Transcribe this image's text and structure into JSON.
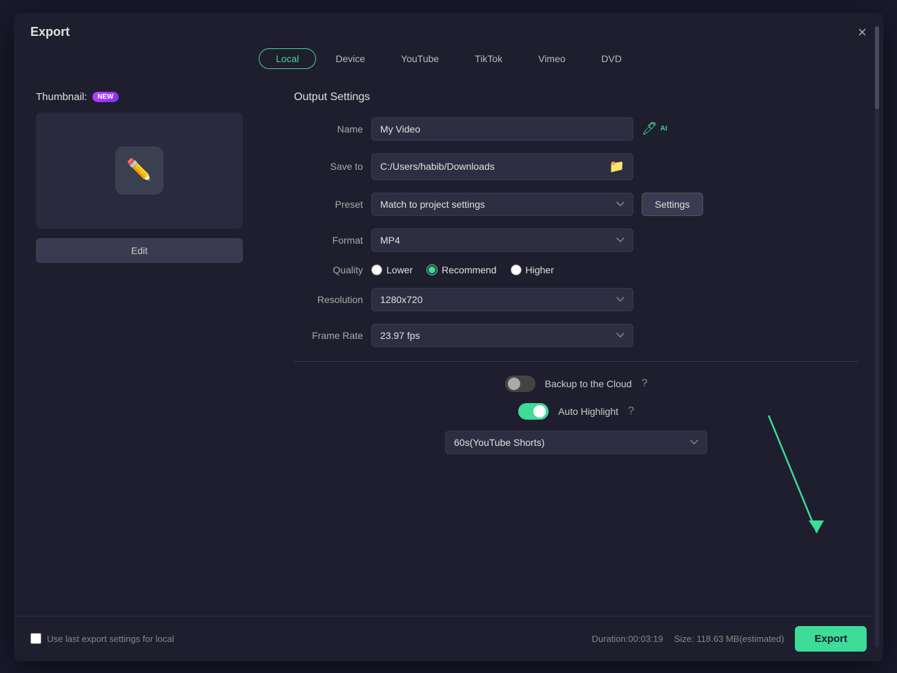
{
  "dialog": {
    "title": "Export",
    "close_label": "×"
  },
  "tabs": {
    "items": [
      {
        "id": "local",
        "label": "Local",
        "active": true
      },
      {
        "id": "device",
        "label": "Device",
        "active": false
      },
      {
        "id": "youtube",
        "label": "YouTube",
        "active": false
      },
      {
        "id": "tiktok",
        "label": "TikTok",
        "active": false
      },
      {
        "id": "vimeo",
        "label": "Vimeo",
        "active": false
      },
      {
        "id": "dvd",
        "label": "DVD",
        "active": false
      }
    ]
  },
  "left_panel": {
    "thumbnail_label": "Thumbnail:",
    "new_badge": "NEW",
    "edit_button": "Edit"
  },
  "output_settings": {
    "section_title": "Output Settings",
    "name_label": "Name",
    "name_value": "My Video",
    "save_to_label": "Save to",
    "save_to_value": "C:/Users/habib/Downloads",
    "preset_label": "Preset",
    "preset_value": "Match to project settings",
    "settings_button": "Settings",
    "format_label": "Format",
    "format_value": "MP4",
    "quality_label": "Quality",
    "quality_options": [
      {
        "id": "lower",
        "label": "Lower",
        "checked": false
      },
      {
        "id": "recommend",
        "label": "Recommend",
        "checked": true
      },
      {
        "id": "higher",
        "label": "Higher",
        "checked": false
      }
    ],
    "resolution_label": "Resolution",
    "resolution_value": "1280x720",
    "framerate_label": "Frame Rate",
    "framerate_value": "23.97 fps",
    "backup_label": "Backup to the Cloud",
    "backup_enabled": false,
    "auto_highlight_label": "Auto Highlight",
    "auto_highlight_enabled": true,
    "duration_value": "60s(YouTube Shorts)"
  },
  "footer": {
    "use_last_label": "Use last export settings for local",
    "duration_text": "Duration:00:03:19",
    "size_text": "Size: 118.63 MB(estimated)",
    "export_button": "Export"
  }
}
